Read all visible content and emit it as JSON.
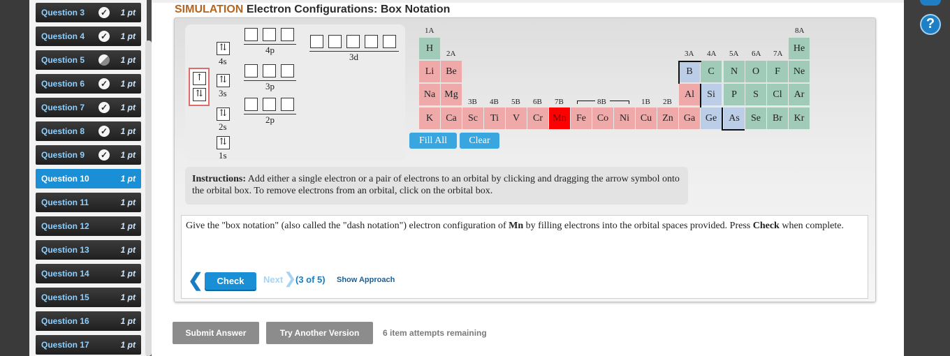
{
  "sidebar": {
    "items": [
      {
        "label": "Question 3",
        "points": "1 pt",
        "status": "correct"
      },
      {
        "label": "Question 4",
        "points": "1 pt",
        "status": "correct"
      },
      {
        "label": "Question 5",
        "points": "1 pt",
        "status": "partial"
      },
      {
        "label": "Question 6",
        "points": "1 pt",
        "status": "correct"
      },
      {
        "label": "Question 7",
        "points": "1 pt",
        "status": "correct"
      },
      {
        "label": "Question 8",
        "points": "1 pt",
        "status": "correct"
      },
      {
        "label": "Question 9",
        "points": "1 pt",
        "status": "correct"
      },
      {
        "label": "Question 10",
        "points": "1 pt",
        "status": "active"
      },
      {
        "label": "Question 11",
        "points": "1 pt",
        "status": "none"
      },
      {
        "label": "Question 12",
        "points": "1 pt",
        "status": "none"
      },
      {
        "label": "Question 13",
        "points": "1 pt",
        "status": "none"
      },
      {
        "label": "Question 14",
        "points": "1 pt",
        "status": "none"
      },
      {
        "label": "Question 15",
        "points": "1 pt",
        "status": "none"
      },
      {
        "label": "Question 16",
        "points": "1 pt",
        "status": "none"
      },
      {
        "label": "Question 17",
        "points": "1 pt",
        "status": "none"
      }
    ],
    "check_glyph": "✓"
  },
  "header": {
    "tag": "SIMULATION",
    "title": "Electron Configurations: Box Notation",
    "help_icon": "?"
  },
  "orbitals": {
    "labels": {
      "s4": "4s",
      "s3": "3s",
      "s2": "2s",
      "s1": "1s",
      "p4": "4p",
      "p3": "3p",
      "p2": "2p",
      "d3": "3d"
    },
    "filled": {
      "s4": "⇅",
      "s3": "⇅",
      "s2": "⇅",
      "s1": "⇅"
    },
    "palette": {
      "single": "↑",
      "pair": "⇅"
    }
  },
  "periodic_table": {
    "groups": {
      "g1A": "1A",
      "g2A": "2A",
      "g3A": "3A",
      "g4A": "4A",
      "g5A": "5A",
      "g6A": "6A",
      "g7A": "7A",
      "g8A": "8A",
      "g3B": "3B",
      "g4B": "4B",
      "g5B": "5B",
      "g6B": "6B",
      "g7B": "7B",
      "g8B": "8B",
      "g1B": "1B",
      "g2B": "2B"
    },
    "highlighted": "Mn",
    "colors": {
      "metal": "#f0a9a9",
      "nonmetal": "#9fcbb8",
      "metalloid": "#bccde8",
      "selected": "#ff0000"
    }
  },
  "buttons": {
    "fill_all": "Fill All",
    "clear": "Clear"
  },
  "instructions": {
    "bold": "Instructions:",
    "text": " Add either a single electron or a pair of electrons to an orbital by clicking and dragging the arrow symbol onto the orbital box. To remove electrons from an orbital, click on the orbital box."
  },
  "question": {
    "part1": "Give the \"box notation\" (also called the \"dash notation\") electron configuration of ",
    "element": "Mn",
    "part2": " by filling electrons into the orbital spaces provided. Press ",
    "check_word": "Check",
    "part3": " when complete."
  },
  "nav": {
    "back_icon": "❮",
    "check": "Check",
    "next": "Next",
    "next_icon": "❯",
    "count": "(3 of 5)",
    "show_approach": "Show Approach"
  },
  "footer": {
    "submit": "Submit Answer",
    "another": "Try Another Version",
    "attempts": "6 item attempts remaining"
  }
}
